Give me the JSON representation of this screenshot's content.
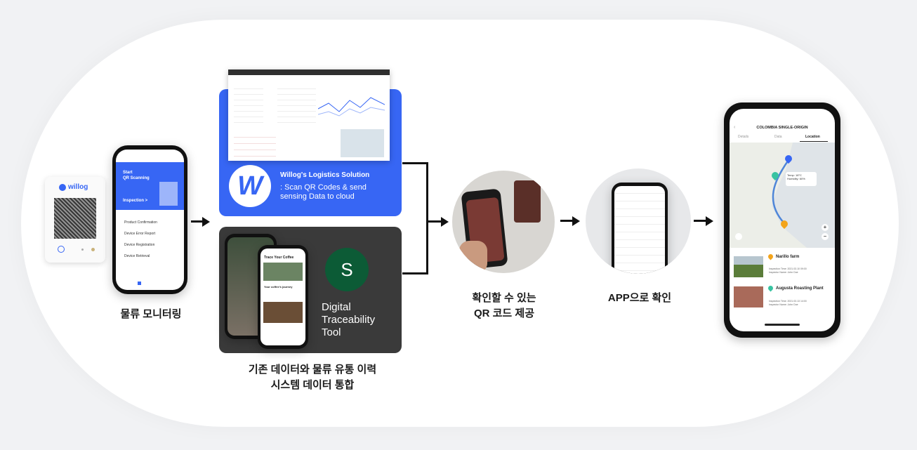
{
  "colors": {
    "blue_card": "#3766f4",
    "dark_card": "#3a3a3a",
    "green": "#0c5b36",
    "accent_orange": "#f3a41b",
    "map_blue": "#4f86d8"
  },
  "device": {
    "brand": "willog"
  },
  "phone1": {
    "title_line1": "Start",
    "title_line2": "QR Scanning",
    "inspection": "Inspection >",
    "menu": [
      "Product Confirmation",
      "Device Error Report",
      "Device Registration",
      "Device Retrieval"
    ]
  },
  "caption1": "물류 모니터링",
  "willog_card": {
    "title": "Willog's Logistics Solution",
    "desc": ": Scan QR Codes & send sensing Data to cloud"
  },
  "trace_card": {
    "logo_letter": "S",
    "title_line1": "Digital",
    "title_line2": "Traceability",
    "title_line3": "Tool",
    "phone_title": "Trace Your Coffee",
    "phone_sub": "Your coffee's journey"
  },
  "caption2": {
    "line1": "기존 데이터와 물류 유통 이력",
    "line2": "시스템 데이터 통합"
  },
  "caption3": {
    "line1": "확인할 수 있는",
    "line2": "QR 코드 제공"
  },
  "caption4": "APP으로 확인",
  "phone_final": {
    "title": "COLOMBIA SINGLE-ORIGIN",
    "tabs": [
      "Details",
      "Data",
      "Location"
    ],
    "legend": [
      "Temp: 18°C",
      "Humidity: 60%"
    ],
    "places": [
      {
        "name": "Narillo farm",
        "line1": "Inspection Time: 2021.03.10 09:00",
        "line2": "Inspector Name: John Doe"
      },
      {
        "name": "Augusta Roasting Plant",
        "line1": "Inspection Time: 2021.03.13 14:00",
        "line2": "Inspector Name: John Doe"
      }
    ]
  }
}
